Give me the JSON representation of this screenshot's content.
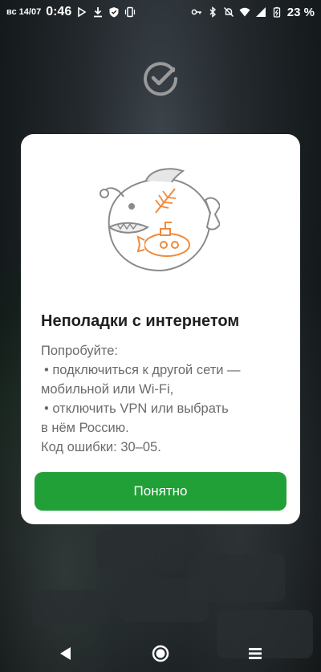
{
  "status_bar": {
    "date": "вс 14/07",
    "time": "0:46",
    "battery": "23 %",
    "left_icons": [
      "play-store-icon",
      "download-icon",
      "shield-icon",
      "vibrate-icon"
    ],
    "right_icons": [
      "key-icon",
      "bluetooth-icon",
      "mute-icon",
      "wifi-icon",
      "signal-icon",
      "battery-icon"
    ]
  },
  "brand": {
    "logo_icon": "sber-logo-icon",
    "accent_color": "#21a038"
  },
  "dialog": {
    "illustration": "anglerfish-submarine-illustration",
    "title": "Неполадки с интернетом",
    "intro": "Попробуйте:",
    "bullet1_line1": "• подключиться к другой сети —",
    "bullet1_line2": "мобильной или Wi-Fi,",
    "bullet2_line1": "• отключить VPN или выбрать",
    "bullet2_line2": "в нём Россию.",
    "error_code": "Код ошибки: 30–05.",
    "button_label": "Понятно"
  },
  "nav_bar": {
    "back_icon": "back-triangle-icon",
    "home_icon": "home-circle-icon",
    "menu_icon": "menu-lines-icon"
  }
}
